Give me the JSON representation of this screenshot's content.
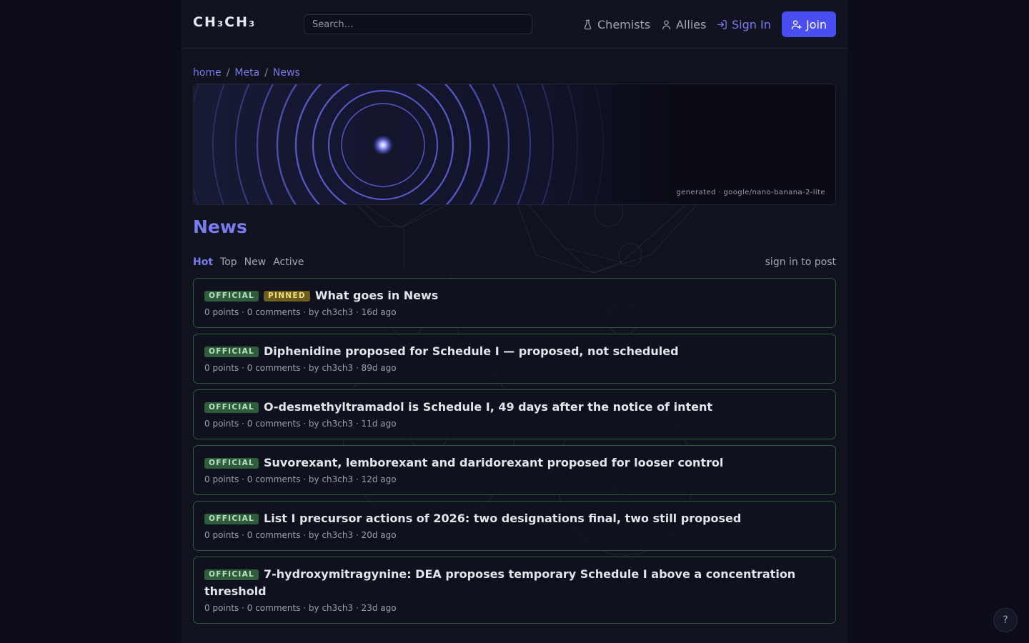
{
  "header": {
    "logo": "CH₃CH₃",
    "search_placeholder": "Search…",
    "nav": {
      "chemists": "Chemists",
      "allies": "Allies",
      "sign_in": "Sign In",
      "join": "Join"
    }
  },
  "breadcrumb": {
    "items": [
      "home",
      "Meta",
      "News"
    ],
    "separator": "/"
  },
  "banner": {
    "caption": "generated · google/nano-banana-2-lite"
  },
  "page": {
    "title": "News",
    "tabs": [
      "Hot",
      "Top",
      "New",
      "Active"
    ],
    "active_tab": "Hot",
    "sign_in_to_post": "sign in to post"
  },
  "posts": [
    {
      "badges": [
        "OFFICIAL",
        "PINNED"
      ],
      "title": "What goes in News",
      "meta": "0 points · 0 comments · by ch3ch3 · 16d ago"
    },
    {
      "badges": [
        "OFFICIAL"
      ],
      "title": "Diphenidine proposed for Schedule I — proposed, not scheduled",
      "meta": "0 points · 0 comments · by ch3ch3 · 89d ago"
    },
    {
      "badges": [
        "OFFICIAL"
      ],
      "title": "O-desmethyltramadol is Schedule I, 49 days after the notice of intent",
      "meta": "0 points · 0 comments · by ch3ch3 · 11d ago"
    },
    {
      "badges": [
        "OFFICIAL"
      ],
      "title": "Suvorexant, lemborexant and daridorexant proposed for looser control",
      "meta": "0 points · 0 comments · by ch3ch3 · 12d ago"
    },
    {
      "badges": [
        "OFFICIAL"
      ],
      "title": "List I precursor actions of 2026: two designations final, two still proposed",
      "meta": "0 points · 0 comments · by ch3ch3 · 20d ago"
    },
    {
      "badges": [
        "OFFICIAL"
      ],
      "title": "7-hydroxymitragynine: DEA proposes temporary Schedule I above a concentration threshold",
      "meta": "0 points · 0 comments · by ch3ch3 · 23d ago"
    }
  ],
  "help_button": "?",
  "colors": {
    "accent": "#7c7cf2",
    "join_bg": "#4a4ef0",
    "official_badge": "#2f5c3d",
    "pinned_badge": "#6b5e1e",
    "post_border": "#2e5a3e"
  }
}
